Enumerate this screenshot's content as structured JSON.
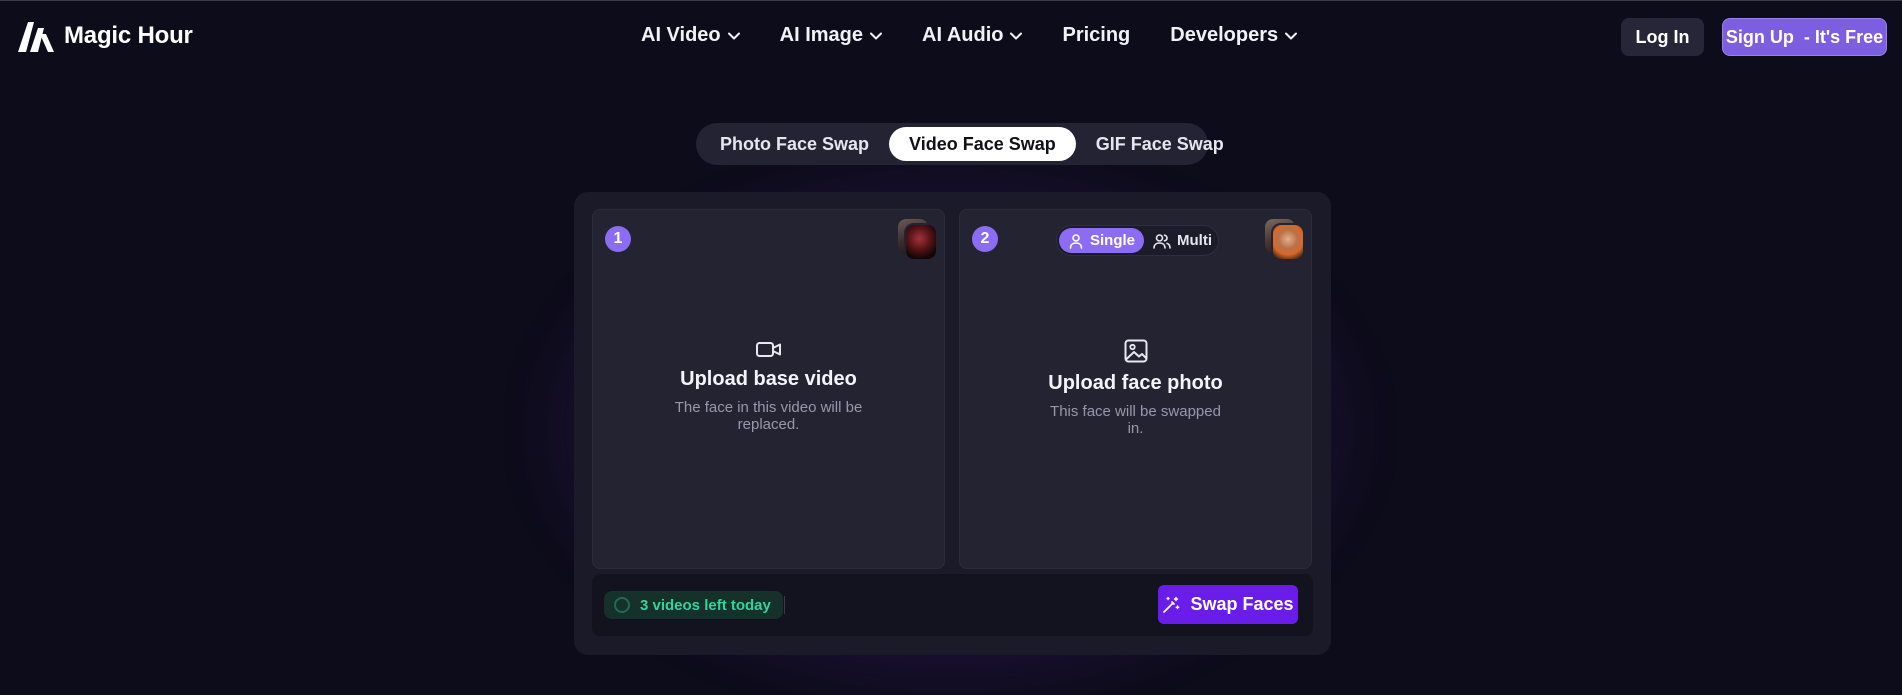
{
  "header": {
    "brand": "Magic Hour",
    "nav": [
      {
        "label": "AI Video",
        "dropdown": true
      },
      {
        "label": "AI Image",
        "dropdown": true
      },
      {
        "label": "AI Audio",
        "dropdown": true
      },
      {
        "label": "Pricing",
        "dropdown": false
      },
      {
        "label": "Developers",
        "dropdown": true
      }
    ],
    "login_label": "Log In",
    "signup_label": "Sign Up  - It's Free"
  },
  "tabs": [
    {
      "label": "Photo Face Swap",
      "active": false
    },
    {
      "label": "Video Face Swap",
      "active": true
    },
    {
      "label": "GIF Face Swap",
      "active": false
    }
  ],
  "upload_video": {
    "step": "1",
    "icon": "video-camera-icon",
    "title": "Upload base video",
    "description": "The face in this video will be replaced."
  },
  "upload_face": {
    "step": "2",
    "icon": "image-icon",
    "title": "Upload face photo",
    "description": "This face will be swapped in.",
    "modes": [
      {
        "label": "Single",
        "icon": "user-icon",
        "active": true
      },
      {
        "label": "Multi",
        "icon": "users-icon",
        "active": false
      }
    ]
  },
  "footer": {
    "credits_text": "3 videos left today",
    "swap_label": "Swap Faces",
    "swap_icon": "magic-wand-icon"
  },
  "colors": {
    "background": "#0d0c1a",
    "accent": "#8b6cf3",
    "primary_button": "#6a1dea",
    "success": "#34d399"
  }
}
